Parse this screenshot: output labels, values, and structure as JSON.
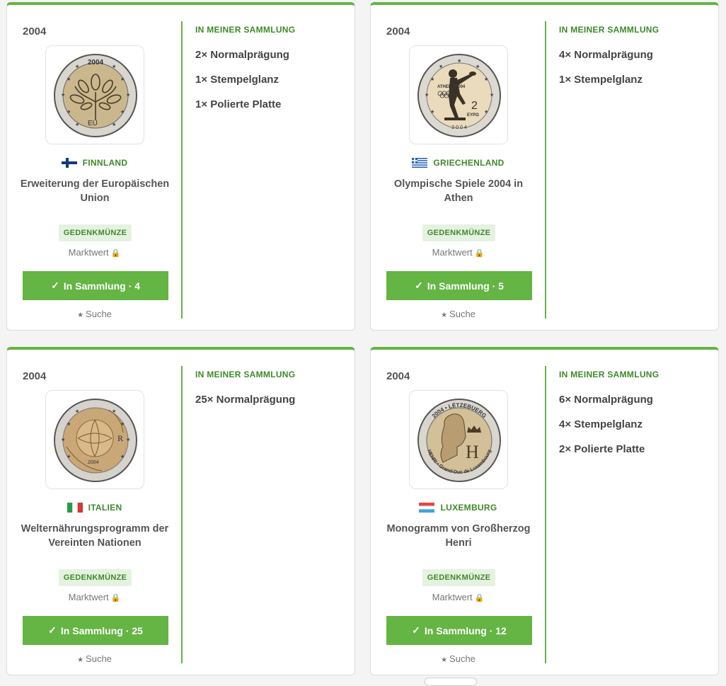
{
  "cards": [
    {
      "year": "2004",
      "country": "FINNLAND",
      "flag": "finland-flag",
      "name": "Erweiterung der Europäischen Union",
      "badge": "GEDENKMÜNZE",
      "market_label": "Marktwert",
      "button_label": "In Sammlung · 4",
      "search_label": "Suche",
      "collection_heading": "IN MEINER SAMMLUNG",
      "collection": [
        "2× Normalprägung",
        "1× Stempelglanz",
        "1× Polierte Platte"
      ]
    },
    {
      "year": "2004",
      "country": "GRIECHENLAND",
      "flag": "greece-flag",
      "name": "Olympische Spiele 2004 in Athen",
      "badge": "GEDENKMÜNZE",
      "market_label": "Marktwert",
      "button_label": "In Sammlung · 5",
      "search_label": "Suche",
      "collection_heading": "IN MEINER SAMMLUNG",
      "collection": [
        "4× Normalprägung",
        "1× Stempelglanz"
      ]
    },
    {
      "year": "2004",
      "country": "ITALIEN",
      "flag": "italy-flag",
      "name": "Welternährungsprogramm der Vereinten Nationen",
      "badge": "GEDENKMÜNZE",
      "market_label": "Marktwert",
      "button_label": "In Sammlung · 25",
      "search_label": "Suche",
      "collection_heading": "IN MEINER SAMMLUNG",
      "collection": [
        "25× Normalprägung"
      ]
    },
    {
      "year": "2004",
      "country": "LUXEMBURG",
      "flag": "luxembourg-flag",
      "name": "Monogramm von Großherzog Henri",
      "badge": "GEDENKMÜNZE",
      "market_label": "Marktwert",
      "button_label": "In Sammlung · 12",
      "search_label": "Suche",
      "collection_heading": "IN MEINER SAMMLUNG",
      "collection": [
        "6× Normalprägung",
        "4× Stempelglanz",
        "2× Polierte Platte"
      ]
    }
  ],
  "coins": {
    "finland": {
      "top": "2004",
      "bottom": "EU"
    },
    "greece": {
      "text": "ATHENS 2004",
      "value": "2",
      "unit": "ΕΥΡΩ",
      "year": "2 0 0 4"
    },
    "italy": {
      "letter": "R",
      "year": "2004"
    },
    "luxembourg": {
      "top": "2004 • LËTZEBUERG",
      "bottom": "HENRI • Grand-Duc de Luxembourg",
      "letter": "H"
    }
  },
  "icons": {
    "lock": "lock-icon",
    "check": "check-icon",
    "star": "star-icon"
  },
  "colors": {
    "accent": "#64b543",
    "accent_text": "#3d8a2a",
    "badge_bg": "#e6f2e1"
  }
}
